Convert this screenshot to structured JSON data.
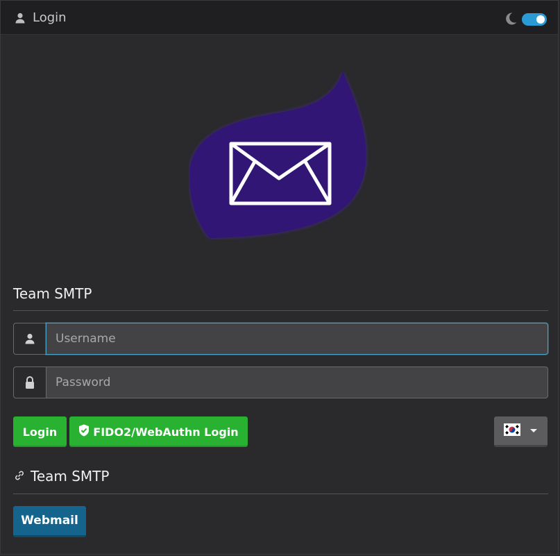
{
  "header": {
    "title": "Login",
    "user_icon": "user-icon",
    "theme_icon": "moon-icon",
    "dark_mode_on": true
  },
  "logo": {
    "icon": "envelope-icon",
    "colors": {
      "leaf": "#321675",
      "envelope": "#ffffff"
    }
  },
  "form": {
    "section_title": "Team SMTP",
    "username": {
      "placeholder": "Username",
      "value": "",
      "icon": "user-icon"
    },
    "password": {
      "placeholder": "Password",
      "value": "",
      "icon": "lock-icon"
    },
    "login_label": "Login",
    "fido_label": "FIDO2/WebAuthn Login",
    "fido_icon": "shield-check-icon",
    "language": {
      "selected": "ko",
      "flag_icon": "korea-flag-icon"
    }
  },
  "links": {
    "title": "Team SMTP",
    "icon": "link-icon",
    "webmail_label": "Webmail"
  },
  "colors": {
    "accent_green": "#29b132",
    "accent_blue": "#15648e",
    "toggle": "#2b9bd6",
    "background": "#2a2a2c"
  }
}
